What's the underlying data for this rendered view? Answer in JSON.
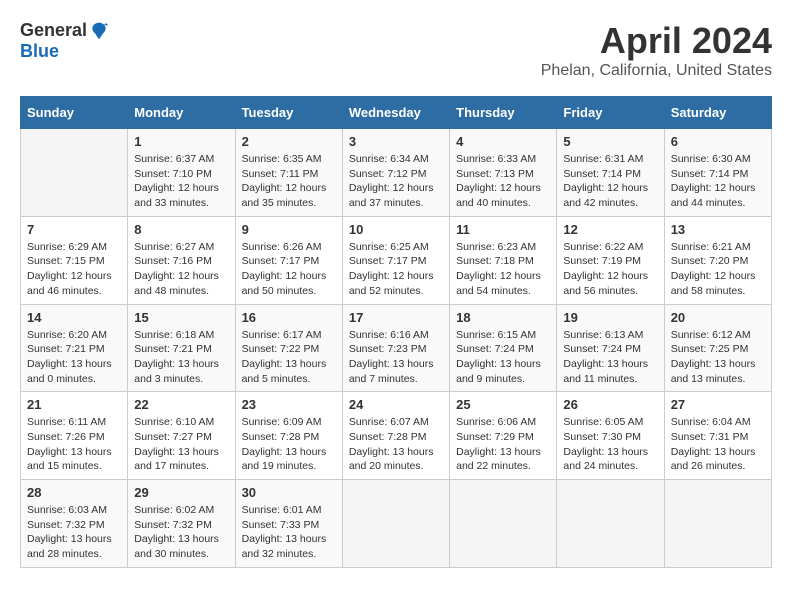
{
  "header": {
    "logo_general": "General",
    "logo_blue": "Blue",
    "month": "April 2024",
    "location": "Phelan, California, United States"
  },
  "days_of_week": [
    "Sunday",
    "Monday",
    "Tuesday",
    "Wednesday",
    "Thursday",
    "Friday",
    "Saturday"
  ],
  "weeks": [
    [
      {
        "day": "",
        "info": ""
      },
      {
        "day": "1",
        "info": "Sunrise: 6:37 AM\nSunset: 7:10 PM\nDaylight: 12 hours\nand 33 minutes."
      },
      {
        "day": "2",
        "info": "Sunrise: 6:35 AM\nSunset: 7:11 PM\nDaylight: 12 hours\nand 35 minutes."
      },
      {
        "day": "3",
        "info": "Sunrise: 6:34 AM\nSunset: 7:12 PM\nDaylight: 12 hours\nand 37 minutes."
      },
      {
        "day": "4",
        "info": "Sunrise: 6:33 AM\nSunset: 7:13 PM\nDaylight: 12 hours\nand 40 minutes."
      },
      {
        "day": "5",
        "info": "Sunrise: 6:31 AM\nSunset: 7:14 PM\nDaylight: 12 hours\nand 42 minutes."
      },
      {
        "day": "6",
        "info": "Sunrise: 6:30 AM\nSunset: 7:14 PM\nDaylight: 12 hours\nand 44 minutes."
      }
    ],
    [
      {
        "day": "7",
        "info": "Sunrise: 6:29 AM\nSunset: 7:15 PM\nDaylight: 12 hours\nand 46 minutes."
      },
      {
        "day": "8",
        "info": "Sunrise: 6:27 AM\nSunset: 7:16 PM\nDaylight: 12 hours\nand 48 minutes."
      },
      {
        "day": "9",
        "info": "Sunrise: 6:26 AM\nSunset: 7:17 PM\nDaylight: 12 hours\nand 50 minutes."
      },
      {
        "day": "10",
        "info": "Sunrise: 6:25 AM\nSunset: 7:17 PM\nDaylight: 12 hours\nand 52 minutes."
      },
      {
        "day": "11",
        "info": "Sunrise: 6:23 AM\nSunset: 7:18 PM\nDaylight: 12 hours\nand 54 minutes."
      },
      {
        "day": "12",
        "info": "Sunrise: 6:22 AM\nSunset: 7:19 PM\nDaylight: 12 hours\nand 56 minutes."
      },
      {
        "day": "13",
        "info": "Sunrise: 6:21 AM\nSunset: 7:20 PM\nDaylight: 12 hours\nand 58 minutes."
      }
    ],
    [
      {
        "day": "14",
        "info": "Sunrise: 6:20 AM\nSunset: 7:21 PM\nDaylight: 13 hours\nand 0 minutes."
      },
      {
        "day": "15",
        "info": "Sunrise: 6:18 AM\nSunset: 7:21 PM\nDaylight: 13 hours\nand 3 minutes."
      },
      {
        "day": "16",
        "info": "Sunrise: 6:17 AM\nSunset: 7:22 PM\nDaylight: 13 hours\nand 5 minutes."
      },
      {
        "day": "17",
        "info": "Sunrise: 6:16 AM\nSunset: 7:23 PM\nDaylight: 13 hours\nand 7 minutes."
      },
      {
        "day": "18",
        "info": "Sunrise: 6:15 AM\nSunset: 7:24 PM\nDaylight: 13 hours\nand 9 minutes."
      },
      {
        "day": "19",
        "info": "Sunrise: 6:13 AM\nSunset: 7:24 PM\nDaylight: 13 hours\nand 11 minutes."
      },
      {
        "day": "20",
        "info": "Sunrise: 6:12 AM\nSunset: 7:25 PM\nDaylight: 13 hours\nand 13 minutes."
      }
    ],
    [
      {
        "day": "21",
        "info": "Sunrise: 6:11 AM\nSunset: 7:26 PM\nDaylight: 13 hours\nand 15 minutes."
      },
      {
        "day": "22",
        "info": "Sunrise: 6:10 AM\nSunset: 7:27 PM\nDaylight: 13 hours\nand 17 minutes."
      },
      {
        "day": "23",
        "info": "Sunrise: 6:09 AM\nSunset: 7:28 PM\nDaylight: 13 hours\nand 19 minutes."
      },
      {
        "day": "24",
        "info": "Sunrise: 6:07 AM\nSunset: 7:28 PM\nDaylight: 13 hours\nand 20 minutes."
      },
      {
        "day": "25",
        "info": "Sunrise: 6:06 AM\nSunset: 7:29 PM\nDaylight: 13 hours\nand 22 minutes."
      },
      {
        "day": "26",
        "info": "Sunrise: 6:05 AM\nSunset: 7:30 PM\nDaylight: 13 hours\nand 24 minutes."
      },
      {
        "day": "27",
        "info": "Sunrise: 6:04 AM\nSunset: 7:31 PM\nDaylight: 13 hours\nand 26 minutes."
      }
    ],
    [
      {
        "day": "28",
        "info": "Sunrise: 6:03 AM\nSunset: 7:32 PM\nDaylight: 13 hours\nand 28 minutes."
      },
      {
        "day": "29",
        "info": "Sunrise: 6:02 AM\nSunset: 7:32 PM\nDaylight: 13 hours\nand 30 minutes."
      },
      {
        "day": "30",
        "info": "Sunrise: 6:01 AM\nSunset: 7:33 PM\nDaylight: 13 hours\nand 32 minutes."
      },
      {
        "day": "",
        "info": ""
      },
      {
        "day": "",
        "info": ""
      },
      {
        "day": "",
        "info": ""
      },
      {
        "day": "",
        "info": ""
      }
    ]
  ]
}
